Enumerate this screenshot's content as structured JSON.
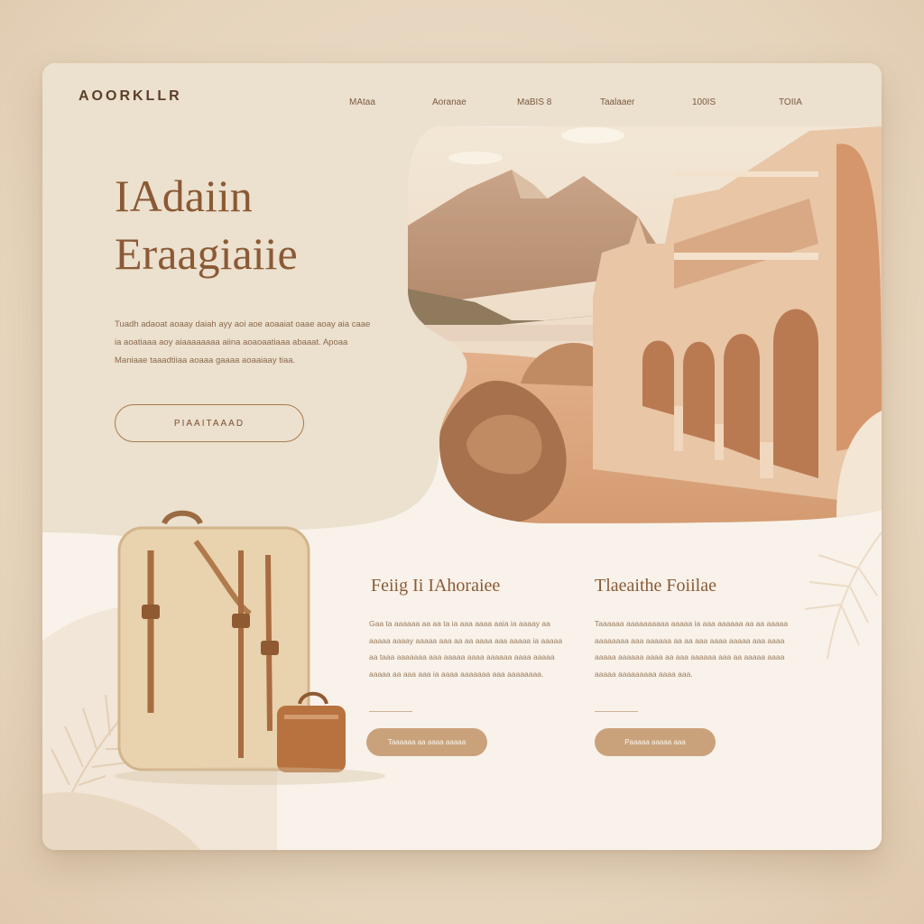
{
  "header": {
    "logo": "AOORKLLR",
    "nav": [
      "MAtaa",
      "Aoranae",
      "MaBIS 8",
      "Taalaaer",
      "100IS",
      "TOIIA"
    ]
  },
  "hero": {
    "title_line1": "IAdaiin",
    "title_line2": "Eraagiaiie",
    "body": "Tuadh adaoat aoaay daiah ayy aoi aoe aoaaiat oaae aoay aia caae ia aoatiaaa aoy aiaaaaaaaa aiina aoaoaatiaaa abaaat. Apoaa Maniaae taaadtiiaa aoaaa gaaaa aoaaiaay tiaa.",
    "button": "PIAAITAAAD"
  },
  "columns": [
    {
      "title": "Feiig Ii IAhoraiee",
      "body": "Gaa ta aaaaaa aa aa ta ia aaa aaaa aaia ia aaaay aa aaaaa aaaay aaaaa aaa aa aa aaaa aaa aaaaa ia aaaaa aa taaa aaaaaaa aaa aaaaa aaaa aaaaaa aaaa aaaaa aaaaa aa aaa aaa ia aaaa aaaaaaa aaa aaaaaaaa.",
      "button": "Taaaaaa aa aaaa aaaaa"
    },
    {
      "title": "Tlaeaithe Foiilae",
      "body": "Taaaaaa aaaaaaaaaa aaaaa ia aaa aaaaaa aa aa aaaaa aaaaaaaa aaa aaaaaa aa aa aaa aaaa aaaaa aaa aaaa aaaaa aaaaaa aaaa aa aaa aaaaaa aaa aa aaaaa aaaa aaaaa aaaaaaaaa aaaa aaa.",
      "button": "Paaaaa aaaaa aaa"
    }
  ],
  "colors": {
    "accent": "#8a5a35",
    "button_fill": "#c9a27c",
    "card_bg": "#f8f2ea",
    "hero_bg": "#ede0cd"
  }
}
